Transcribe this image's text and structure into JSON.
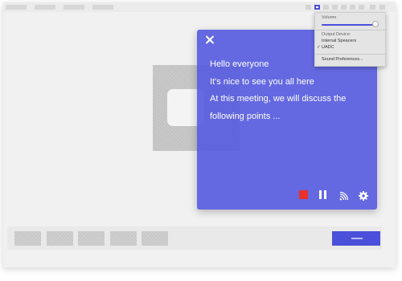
{
  "window": {
    "topbar_items": 4,
    "topbar_icons": 9
  },
  "caption_panel": {
    "lines": [
      "Hello everyone",
      "It's nice to see you all here",
      "At this meeting, we will discuss the",
      "following points ..."
    ],
    "close_icon": "close-icon",
    "controls": [
      {
        "name": "stop",
        "icon": "stop-icon",
        "color": "#e8312a"
      },
      {
        "name": "pause",
        "icon": "pause-icon"
      },
      {
        "name": "cast",
        "icon": "cast-icon"
      },
      {
        "name": "settings",
        "icon": "gear-icon"
      }
    ],
    "background_color": "#585de0"
  },
  "audio_menu": {
    "volume_label": "Volume",
    "volume_level": 0.95,
    "output_device_label": "Output Device:",
    "devices": [
      {
        "name": "Internal Speacers",
        "selected": false
      },
      {
        "name": "UADC",
        "selected": true
      }
    ],
    "checkmark": "✓",
    "sound_preferences": "Sound Preferences..."
  },
  "colors": {
    "accent": "#4a50d9",
    "record": "#e8312a"
  }
}
